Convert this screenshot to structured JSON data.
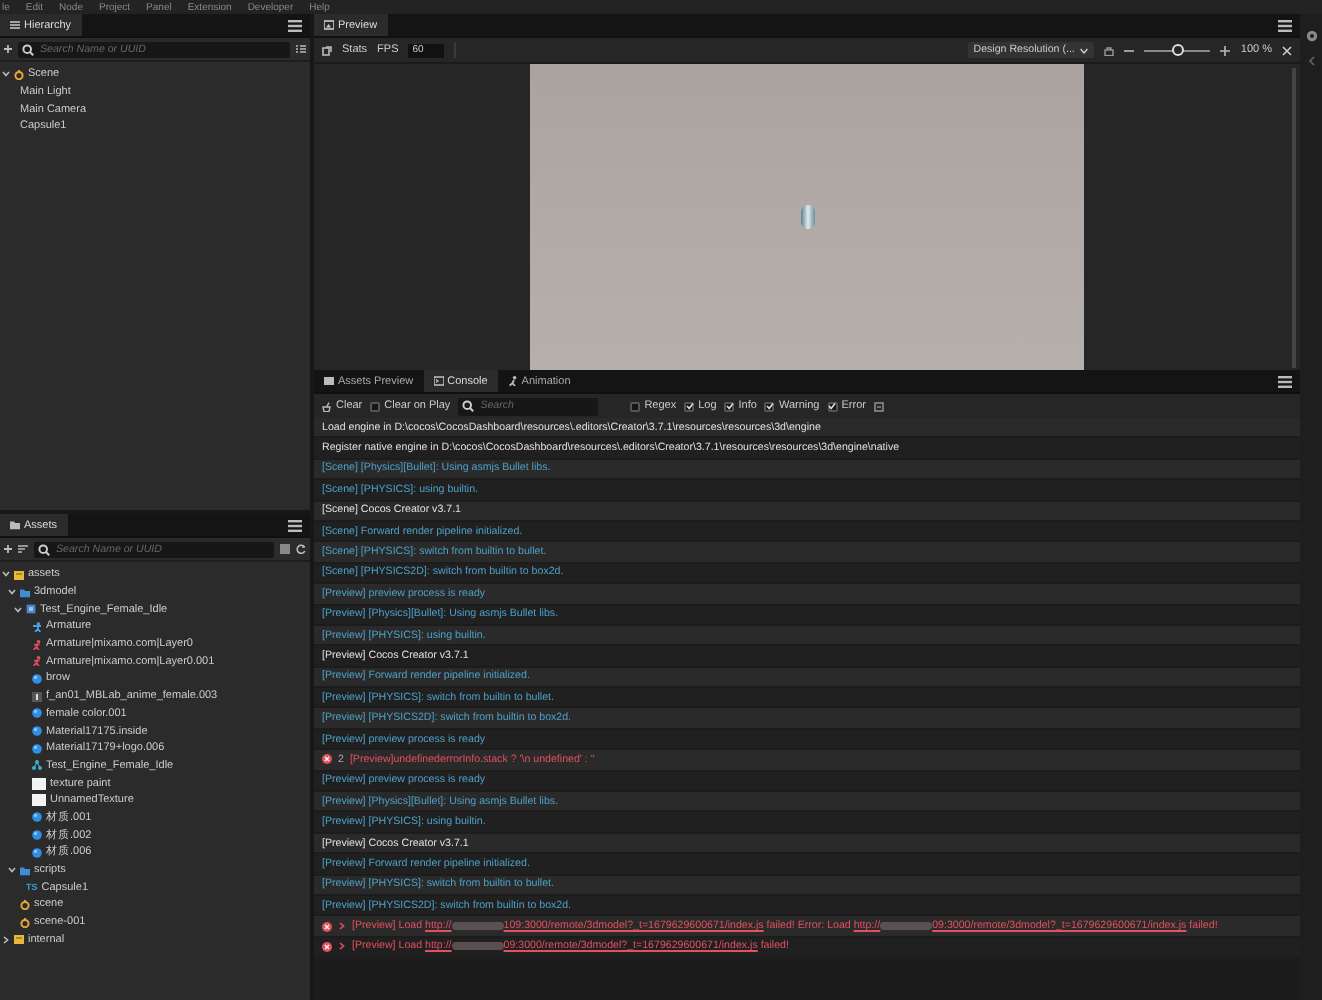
{
  "menu_bar": {
    "items": [
      "le",
      "Edit",
      "Node",
      "Project",
      "Panel",
      "Extension",
      "Developer",
      "Help"
    ]
  },
  "hierarchy": {
    "tab": "Hierarchy",
    "search": {
      "placeholder": "Search Name or UUID"
    },
    "tree": [
      {
        "label": "Scene",
        "kind": "scene",
        "expanded": true,
        "children": [
          {
            "label": "Main Light"
          },
          {
            "label": "Main Camera"
          },
          {
            "label": "Capsule1"
          }
        ]
      }
    ]
  },
  "assets": {
    "tab": "Assets",
    "search": {
      "placeholder": "Search Name or UUID"
    },
    "tree": [
      {
        "label": "assets",
        "kind": "db",
        "expanded": true,
        "children": [
          {
            "label": "3dmodel",
            "kind": "folder",
            "expanded": true,
            "children": [
              {
                "label": "Test_Engine_Female_Idle",
                "kind": "model",
                "expanded": true,
                "children": [
                  {
                    "label": "Armature",
                    "kind": "skeleton"
                  },
                  {
                    "label": "Armature|mixamo.com|Layer0",
                    "kind": "animation"
                  },
                  {
                    "label": "Armature|mixamo.com|Layer0.001",
                    "kind": "animation"
                  },
                  {
                    "label": "brow",
                    "kind": "material"
                  },
                  {
                    "label": "f_an01_MBLab_anime_female.003",
                    "kind": "mesh"
                  },
                  {
                    "label": "female color.001",
                    "kind": "material"
                  },
                  {
                    "label": "Material17175.inside",
                    "kind": "material"
                  },
                  {
                    "label": "Material17179+logo.006",
                    "kind": "material"
                  },
                  {
                    "label": "Test_Engine_Female_Idle",
                    "kind": "prefab"
                  },
                  {
                    "label": "texture paint",
                    "kind": "texture"
                  },
                  {
                    "label": "UnnamedTexture",
                    "kind": "texture"
                  },
                  {
                    "label": "材质.001",
                    "kind": "material"
                  },
                  {
                    "label": "材质.002",
                    "kind": "material"
                  },
                  {
                    "label": "材质.006",
                    "kind": "material"
                  }
                ]
              }
            ]
          },
          {
            "label": "scripts",
            "kind": "folder",
            "expanded": true,
            "children": [
              {
                "label": "Capsule1",
                "kind": "script",
                "badge": "TS"
              }
            ]
          },
          {
            "label": "scene",
            "kind": "scene"
          },
          {
            "label": "scene-001",
            "kind": "scene"
          }
        ]
      },
      {
        "label": "internal",
        "kind": "db",
        "expanded": false
      }
    ]
  },
  "preview": {
    "tab": "Preview",
    "toolbar": {
      "stats": "Stats",
      "fps_label": "FPS",
      "fps_value": "60",
      "resolution": "Design Resolution (...",
      "zoom_slider": {
        "level": 0.5
      },
      "zoom_text": "100 %"
    }
  },
  "console_panel": {
    "tabs": [
      {
        "label": "Assets Preview",
        "selected": false
      },
      {
        "label": "Console",
        "selected": true
      },
      {
        "label": "Animation",
        "selected": false
      }
    ],
    "toolbar": {
      "clear": "Clear",
      "clear_on_play": {
        "label": "Clear on Play",
        "checked": false
      },
      "search": {
        "placeholder": "Search"
      },
      "filters": [
        {
          "label": "Regex",
          "checked": false
        },
        {
          "label": "Log",
          "checked": true
        },
        {
          "label": "Info",
          "checked": true
        },
        {
          "label": "Warning",
          "checked": true
        },
        {
          "label": "Error",
          "checked": true
        }
      ]
    },
    "rows": [
      {
        "kind": "log",
        "text": "Load engine in D:\\cocos\\CocosDashboard\\resources\\.editors\\Creator\\3.7.1\\resources\\resources\\3d\\engine"
      },
      {
        "kind": "log",
        "text": "Register native engine in D:\\cocos\\CocosDashboard\\resources\\.editors\\Creator\\3.7.1\\resources\\resources\\3d\\engine\\native"
      },
      {
        "kind": "info",
        "text": "[Scene] [Physics][Bullet]: Using asmjs Bullet libs."
      },
      {
        "kind": "info",
        "text": "[Scene] [PHYSICS]: using builtin."
      },
      {
        "kind": "log",
        "text": "[Scene] Cocos Creator v3.7.1"
      },
      {
        "kind": "info",
        "text": "[Scene] Forward render pipeline initialized."
      },
      {
        "kind": "info",
        "text": "[Scene] [PHYSICS]: switch from builtin to bullet."
      },
      {
        "kind": "info",
        "text": "[Scene] [PHYSICS2D]: switch from builtin to box2d."
      },
      {
        "kind": "info",
        "text": "[Preview] preview process is ready"
      },
      {
        "kind": "info",
        "text": "[Preview] [Physics][Bullet]: Using asmjs Bullet libs."
      },
      {
        "kind": "info",
        "text": "[Preview] [PHYSICS]: using builtin."
      },
      {
        "kind": "log",
        "text": "[Preview] Cocos Creator v3.7.1"
      },
      {
        "kind": "info",
        "text": "[Preview] Forward render pipeline initialized."
      },
      {
        "kind": "info",
        "text": "[Preview] [PHYSICS]: switch from builtin to bullet."
      },
      {
        "kind": "info",
        "text": "[Preview] [PHYSICS2D]: switch from builtin to box2d."
      },
      {
        "kind": "info",
        "text": "[Preview] preview process is ready"
      },
      {
        "kind": "error",
        "count": "2",
        "text": "[Preview]undefinederrorInfo.stack ? '\\n undefined' : ''"
      },
      {
        "kind": "info",
        "text": "[Preview] preview process is ready"
      },
      {
        "kind": "info",
        "text": "[Preview] [Physics][Bullet]: Using asmjs Bullet libs."
      },
      {
        "kind": "info",
        "text": "[Preview] [PHYSICS]: using builtin."
      },
      {
        "kind": "log",
        "text": "[Preview] Cocos Creator v3.7.1"
      },
      {
        "kind": "info",
        "text": "[Preview] Forward render pipeline initialized."
      },
      {
        "kind": "info",
        "text": "[Preview] [PHYSICS]: switch from builtin to bullet."
      },
      {
        "kind": "info",
        "text": "[Preview] [PHYSICS2D]: switch from builtin to box2d."
      },
      {
        "kind": "error",
        "expanded": false,
        "parts": [
          {
            "kind": "text",
            "text": "[Preview] Load "
          },
          {
            "kind": "link",
            "pre": "http://",
            "post": "109:3000/remote/3dmodel?_t=1679629600671/index.js"
          },
          {
            "kind": "text",
            "text": " failed! Error: Load "
          },
          {
            "kind": "link",
            "pre": "http://",
            "post": "09:3000/remote/3dmodel?_t=1679629600671/index.js"
          },
          {
            "kind": "text",
            "text": " failed!"
          }
        ]
      },
      {
        "kind": "error",
        "expanded": false,
        "parts": [
          {
            "kind": "text",
            "text": "[Preview] Load "
          },
          {
            "kind": "link",
            "pre": "http://",
            "post": "09:3000/remote/3dmodel?_t=1679629600671/index.js"
          },
          {
            "kind": "text",
            "text": " failed!"
          }
        ]
      }
    ]
  }
}
